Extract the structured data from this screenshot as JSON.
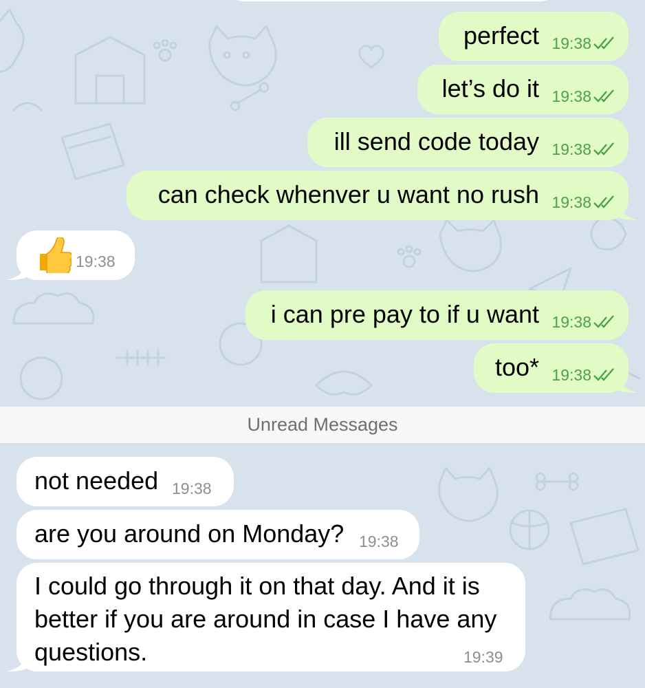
{
  "chat": {
    "messages": [
      {
        "text": "perfect",
        "time": "19:38",
        "direction": "outgoing",
        "status": "read"
      },
      {
        "text": "let’s do it",
        "time": "19:38",
        "direction": "outgoing",
        "status": "read"
      },
      {
        "text": "ill send code today",
        "time": "19:38",
        "direction": "outgoing",
        "status": "read"
      },
      {
        "text": "can check whenver u want no rush",
        "time": "19:38",
        "direction": "outgoing",
        "status": "read"
      },
      {
        "text": "",
        "emoji": "thumbs-up-emoji",
        "time": "19:38",
        "direction": "incoming"
      },
      {
        "text": "i can pre pay to if u want",
        "time": "19:38",
        "direction": "outgoing",
        "status": "read"
      },
      {
        "text": "too*",
        "time": "19:38",
        "direction": "outgoing",
        "status": "read"
      },
      {
        "text": "not needed",
        "time": "19:38",
        "direction": "incoming"
      },
      {
        "text": "are you around on Monday?",
        "time": "19:38",
        "direction": "incoming"
      },
      {
        "lines": [
          "I could go through it on that day. And it is",
          "better if you are around in case I have any",
          "questions."
        ],
        "time": "19:39",
        "direction": "incoming"
      }
    ],
    "unread_divider": "Unread Messages"
  },
  "icons": {
    "read_status": "double-check-icon",
    "reaction": "thumbs-up-emoji"
  },
  "colors": {
    "wallpaper": "#d7e2ec",
    "outgoing_bubble": "#e2fbc6",
    "incoming_bubble": "#ffffff",
    "check": "#4aa24a",
    "divider_bg": "#f6f7f7"
  }
}
